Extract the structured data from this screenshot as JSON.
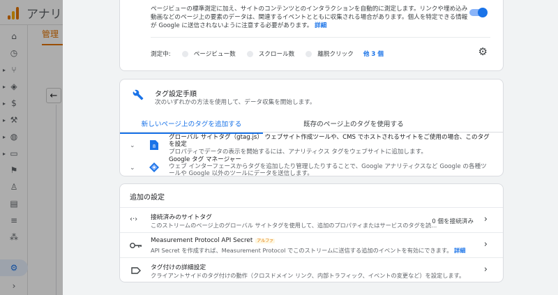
{
  "background": {
    "app_name": "アナリテ",
    "admin_tab": "管理",
    "back_arrow": "←"
  },
  "stream_card": {
    "description": "ページビューの標準測定に加え、サイトのコンテンツとのインタラクションを自動的に測定します。リンクや埋め込み動画などのページ上の要素のデータは、関連するイベントとともに収集される場合があります。個人を特定できる情報が Google に送信されないように注意する必要があります。",
    "details_link": "詳細",
    "measuring_label": "測定中:",
    "metrics": [
      "ページビュー数",
      "スクロール数",
      "離脱クリック"
    ],
    "more_link": "他 3 個",
    "toggle_on": true
  },
  "tag_setup": {
    "title": "タグ設定手順",
    "subtitle": "次のいずれかの方法を使用して、データ収集を開始します。",
    "tabs": [
      {
        "label": "新しいページ上のタグを追加する",
        "selected": true
      },
      {
        "label": "既存のページ上のタグを使用する",
        "selected": false
      }
    ],
    "options": [
      {
        "title": "グローバル サイトタグ（gtag.js） ウェブサイト作成ツールや、CMS でホストされるサイトをご使用の場合、このタグを設定",
        "desc": "プロパティでデータの表示を開始するには、アナリティクス タグをウェブサイトに追加します。",
        "icon": "gtag-file-icon"
      },
      {
        "title": "Google タグ マネージャー",
        "desc": "ウェブ インターフェースからタグを追加したり管理したりすることで、Google アナリティクスなど Google の各種ツールや Google 以外のツールにデータを送信します。",
        "icon": "tag-manager-icon"
      }
    ]
  },
  "additional": {
    "header": "追加の設定",
    "rows": [
      {
        "title": "接続済みのサイトタグ",
        "desc": "このストリームのページ上のグローバル サイトタグを使用して、追加のプロパティまたはサービスのタグを読…",
        "value": "0 個を接続済み",
        "icon": "code-icon"
      },
      {
        "title": "Measurement Protocol API Secret",
        "badge": "アルファ",
        "desc": "API Secret を作成すれば、Measurement Protocol でこのストリームに送信する追加のイベントを有効にできます。",
        "link": "詳細",
        "icon": "key-icon"
      },
      {
        "title": "タグ付けの詳細設定",
        "desc": "クライアントサイドのタグ付けの動作（クロスドメイン リンク、内部トラフィック、イベントの変更など）を設定します。",
        "icon": "label-icon"
      }
    ]
  },
  "colors": {
    "accent": "#1a73e8",
    "brand": "#e37400"
  }
}
